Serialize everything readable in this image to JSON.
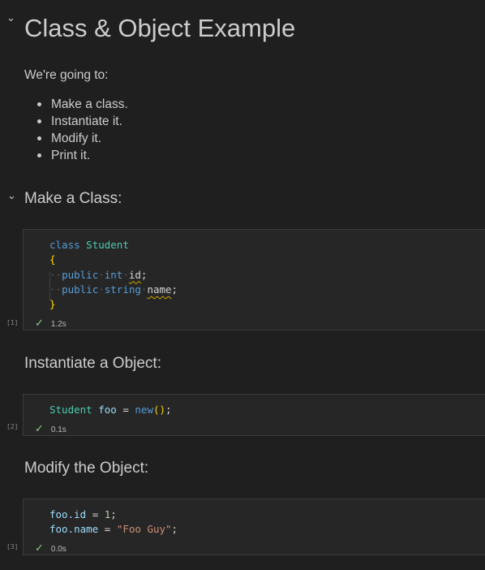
{
  "header": {
    "title": "Class & Object Example"
  },
  "intro": {
    "text": "We're going to:",
    "bullets": [
      "Make a class.",
      "Instantiate it.",
      "Modify it.",
      "Print it."
    ]
  },
  "section1": {
    "title": "Make a Class:"
  },
  "cell1": {
    "exec_count": "[1]",
    "time": "1.2s",
    "code": {
      "l1_kw": "class",
      "l1_type": "Student",
      "l2_brace": "{",
      "l3_mod": "public",
      "l3_type": "int",
      "l3_name": "id",
      "l3_end": ";",
      "l4_mod": "public",
      "l4_type": "string",
      "l4_name": "name",
      "l4_end": ";",
      "l5_brace": "}"
    }
  },
  "section2": {
    "title": "Instantiate a Object:"
  },
  "cell2": {
    "exec_count": "[2]",
    "time": "0.1s",
    "code": {
      "type": "Student",
      "var": "foo",
      "eq": "=",
      "kw": "new",
      "paren": "()",
      "end": ";"
    }
  },
  "section3": {
    "title": "Modify the Object:"
  },
  "cell3": {
    "exec_count": "[3]",
    "time": "0.0s",
    "code": {
      "l1_var": "foo.id",
      "l1_eq": "=",
      "l1_num": "1",
      "l1_end": ";",
      "l2_var": "foo.name",
      "l2_eq": "=",
      "l2_str": "\"Foo Guy\"",
      "l2_end": ";"
    }
  },
  "colors": {
    "background": "#1f1f1f",
    "cell_bg": "#262626",
    "keyword": "#569cd6",
    "type": "#4ec9b0",
    "variable": "#9cdcfe",
    "string": "#ce9178",
    "number": "#b5cea8",
    "success": "#89d185"
  },
  "icons": {
    "collapse": "chevron-down-icon",
    "status": "check-icon"
  }
}
